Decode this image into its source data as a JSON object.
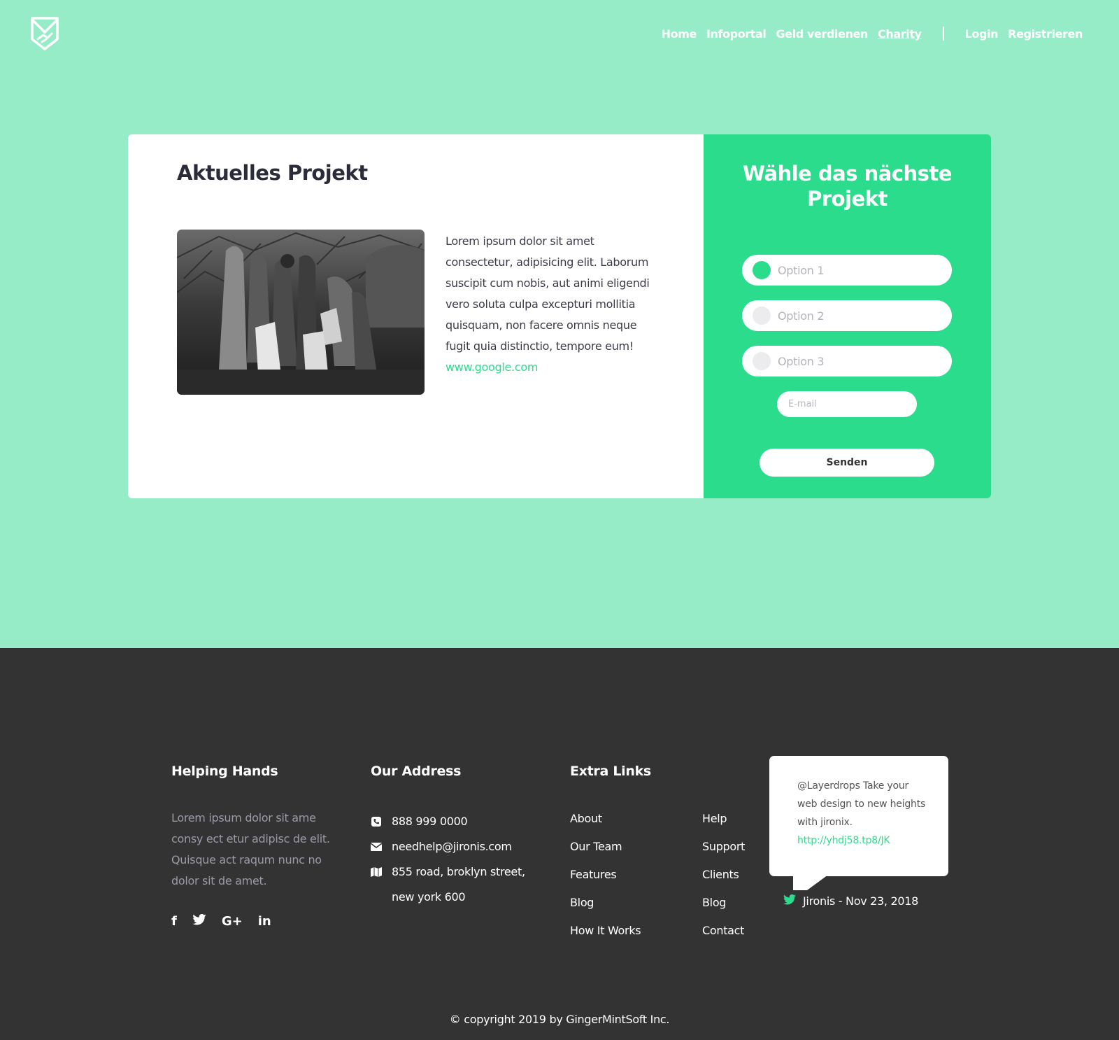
{
  "header": {
    "logo_icon": "shield-handshake-icon",
    "nav": [
      {
        "label": "Home",
        "active": false
      },
      {
        "label": "Infoportal",
        "active": false
      },
      {
        "label": "Geld verdienen",
        "active": false
      },
      {
        "label": "Charity",
        "active": true
      }
    ],
    "login_label": "Login",
    "register_label": "Registrieren"
  },
  "current_project": {
    "title": "Aktuelles Projekt",
    "image_alt": "project-photo",
    "text": "Lorem ipsum dolor sit amet consectetur, adipisicing elit. Laborum suscipit cum nobis, aut animi eligendi vero soluta culpa excepturi mollitia quisquam, non facere omnis neque fugit quia distinctio, tempore eum!",
    "link": "www.google.com"
  },
  "vote": {
    "title": "Wähle das nächste Projekt",
    "options": [
      {
        "label": "Option 1",
        "selected": true
      },
      {
        "label": "Option 2",
        "selected": false
      },
      {
        "label": "Option 3",
        "selected": false
      }
    ],
    "email_placeholder": "E-mail",
    "submit_label": "Senden"
  },
  "footer": {
    "about": {
      "title": "Helping Hands",
      "text": "Lorem ipsum dolor sit ame consy ect etur adipisc de elit. Quisque act raqum nunc no dolor sit de amet.",
      "social": [
        "f",
        "t",
        "G+",
        "in"
      ]
    },
    "address": {
      "title": "Our Address",
      "phone": "888 999 0000",
      "email": "needhelp@jironis.com",
      "street": "855 road, broklyn street,",
      "city": "new york 600"
    },
    "links": {
      "title": "Extra Links",
      "col1": [
        "About",
        "Our Team",
        "Features",
        "Blog",
        "How It Works"
      ],
      "col2": [
        "Help",
        "Support",
        "Clients",
        "Blog",
        "Contact"
      ]
    },
    "tweet": {
      "text": "@Layerdrops Take your web design to new heights with jironix.",
      "link": "http://yhdj58.tp8/JK",
      "meta": "Jironis - Nov 23, 2018"
    },
    "copyright": "© copyright 2019 by GingerMintSoft Inc."
  },
  "colors": {
    "background": "#96ecc6",
    "accent": "#2cdc8d",
    "footer": "#333333"
  }
}
